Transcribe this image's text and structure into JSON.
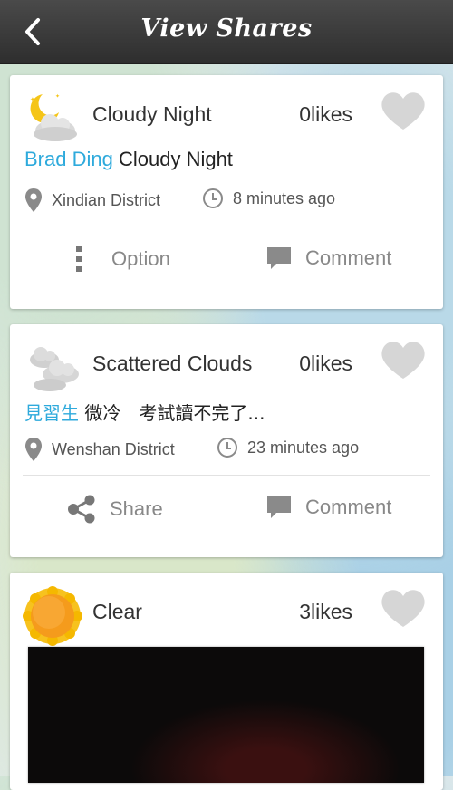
{
  "header": {
    "title": "View Shares",
    "back_icon": "chevron-left-icon"
  },
  "posts": [
    {
      "weather": "Cloudy Night",
      "weather_icon": "cloudy-night-icon",
      "likes": "0likes",
      "user": "Brad Ding",
      "message": "Cloudy Night",
      "location": "Xindian District",
      "time": "8 minutes ago",
      "action_left": "Option",
      "action_right": "Comment"
    },
    {
      "weather": "Scattered Clouds",
      "weather_icon": "scattered-clouds-icon",
      "likes": "0likes",
      "user": "見習生",
      "message": "微冷　考試讀不完了...",
      "location": "Wenshan District",
      "time": "23 minutes ago",
      "action_left": "Share",
      "action_right": "Comment"
    },
    {
      "weather": "Clear",
      "weather_icon": "sun-icon",
      "likes": "3likes"
    }
  ],
  "colors": {
    "accent": "#2eaadc",
    "topbar": "#3a3a3a",
    "heart": "#d6d6d6"
  }
}
